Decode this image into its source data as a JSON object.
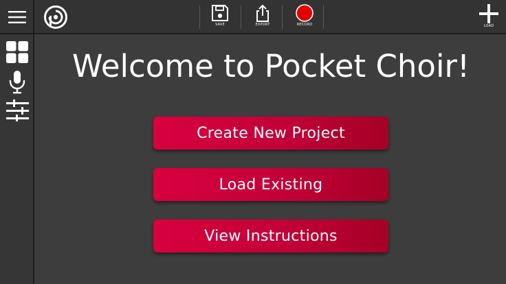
{
  "app": {
    "title": "Welcome to Pocket Choir!",
    "logo_icon": "pocket-choir-logo-icon"
  },
  "toolbar": {
    "menu_icon": "hamburger-menu-icon",
    "save_label": "SAVE",
    "export_label": "EXPORT",
    "record_label": "RECORD",
    "load_label": "LOAD"
  },
  "sidebar": {
    "items": [
      {
        "icon": "grid-icon",
        "name": "grid"
      },
      {
        "icon": "microphone-icon",
        "name": "microphone"
      },
      {
        "icon": "sliders-icon",
        "name": "mixer"
      }
    ]
  },
  "main": {
    "buttons": [
      {
        "label": "Create New Project"
      },
      {
        "label": "Load Existing"
      },
      {
        "label": "View Instructions"
      }
    ]
  },
  "colors": {
    "background": "#3d3d3d",
    "bar": "#333333",
    "accent": "#c8003a",
    "record": "#e50000"
  }
}
